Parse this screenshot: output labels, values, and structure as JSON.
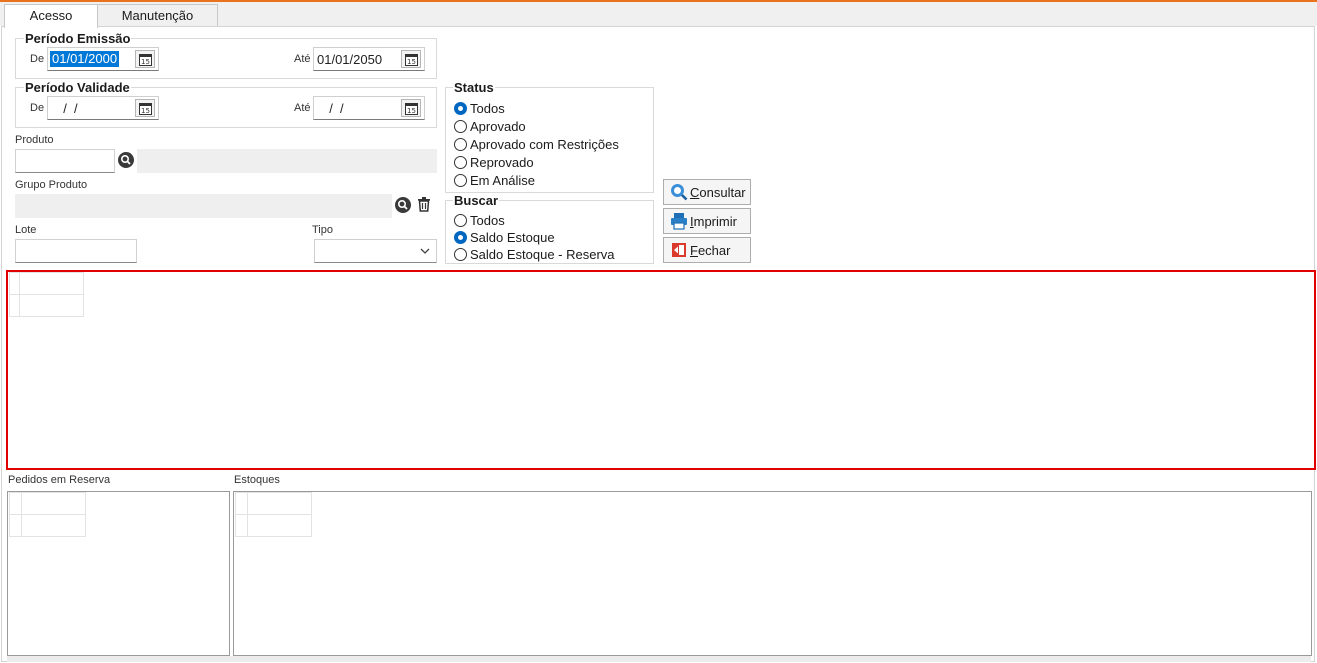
{
  "tabs": [
    {
      "label": "Acesso",
      "active": true
    },
    {
      "label": "Manutenção",
      "active": false
    }
  ],
  "periodo_emissao": {
    "title": "Período Emissão",
    "de_label": "De",
    "de_value": "01/01/2000",
    "ate_label": "Até",
    "ate_value": "01/01/2050"
  },
  "periodo_validade": {
    "title": "Período Validade",
    "de_label": "De",
    "de_value": "  /  /",
    "ate_label": "Até",
    "ate_value": "  /  /"
  },
  "produto": {
    "label": "Produto",
    "code_value": "",
    "desc_value": ""
  },
  "grupo_produto": {
    "label": "Grupo Produto",
    "value": ""
  },
  "lote": {
    "label": "Lote",
    "value": ""
  },
  "tipo": {
    "label": "Tipo",
    "selected": ""
  },
  "status": {
    "title": "Status",
    "options": [
      "Todos",
      "Aprovado",
      "Aprovado com Restrições",
      "Reprovado",
      "Em Análise"
    ],
    "selected_index": 0
  },
  "buscar": {
    "title": "Buscar",
    "options": [
      "Todos",
      "Saldo Estoque",
      "Saldo Estoque - Reserva"
    ],
    "selected_index": 1
  },
  "buttons": {
    "consultar": {
      "mnemonic": "C",
      "rest": "onsultar",
      "icon": "search-icon"
    },
    "imprimir": {
      "mnemonic": "I",
      "rest": "mprimir",
      "icon": "printer-icon"
    },
    "fechar": {
      "mnemonic": "F",
      "rest": "echar",
      "icon": "exit-icon"
    }
  },
  "pedidos_reserva": {
    "label": "Pedidos em Reserva"
  },
  "estoques": {
    "label": "Estoques"
  },
  "colors": {
    "accent": "#e8731c",
    "selection": "#0078d7",
    "radio_on": "#0067c0",
    "highlight_border": "#e00000"
  }
}
